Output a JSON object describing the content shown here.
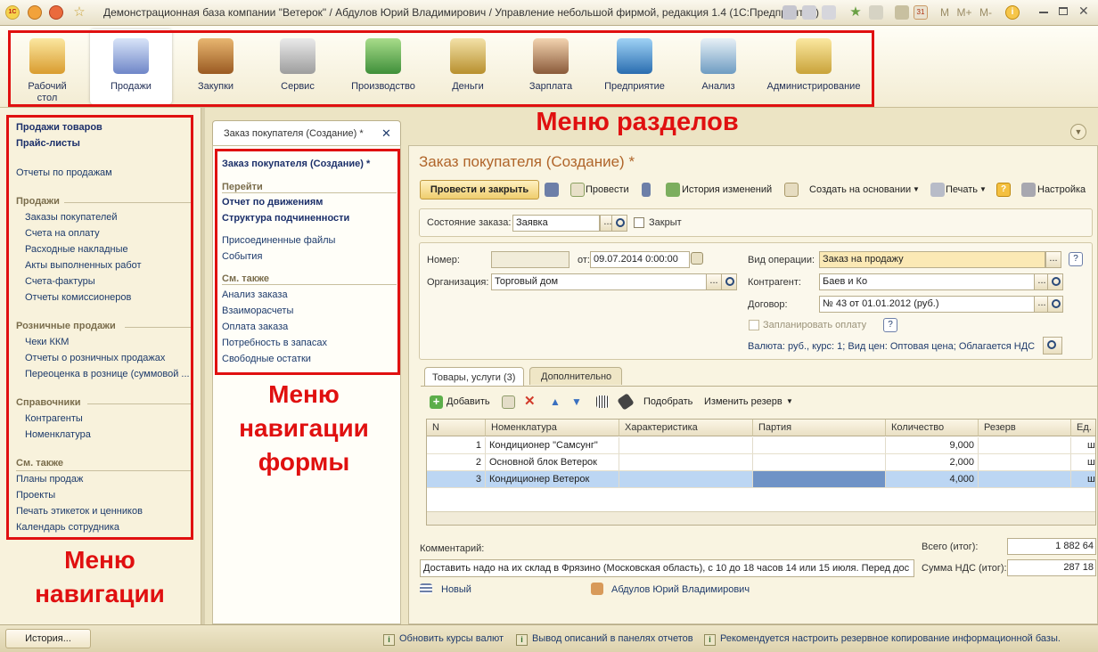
{
  "window": {
    "title": "Демонстрационная база компании \"Ветерок\" / Абдулов Юрий Владимирович / Управление небольшой фирмой, редакция 1.4  (1С:Предприятие)",
    "logo_text": "1С",
    "right_controls": [
      "M",
      "M+",
      "M-"
    ]
  },
  "sections": [
    {
      "label": "Рабочий стол",
      "icon": "desktop-icon"
    },
    {
      "label": "Продажи",
      "icon": "cart-icon",
      "active": true
    },
    {
      "label": "Закупки",
      "icon": "boxes-icon"
    },
    {
      "label": "Сервис",
      "icon": "tools-icon"
    },
    {
      "label": "Производство",
      "icon": "factory-icon"
    },
    {
      "label": "Деньги",
      "icon": "coins-icon"
    },
    {
      "label": "Зарплата",
      "icon": "employee-icon"
    },
    {
      "label": "Предприятие",
      "icon": "building-icon"
    },
    {
      "label": "Анализ",
      "icon": "chart-icon"
    },
    {
      "label": "Администрирование",
      "icon": "database-icon"
    }
  ],
  "annotations": {
    "sections_menu": "Меню разделов",
    "form_nav_menu_lines": [
      "Меню",
      "навигации",
      "формы"
    ],
    "nav_menu_lines": [
      "Меню",
      "навигации"
    ]
  },
  "left_nav": {
    "top_bold": [
      "Продажи товаров",
      "Прайс-листы"
    ],
    "reports": "Отчеты по продажам",
    "groups": [
      {
        "title": "Продажи",
        "items": [
          "Заказы покупателей",
          "Счета на оплату",
          "Расходные накладные",
          "Акты выполненных работ",
          "Счета-фактуры",
          "Отчеты комиссионеров"
        ]
      },
      {
        "title": "Розничные продажи",
        "items": [
          "Чеки ККМ",
          "Отчеты о розничных продажах",
          "Переоценка в рознице (суммовой ..."
        ]
      },
      {
        "title": "Справочники",
        "items": [
          "Контрагенты",
          "Номенклатура"
        ]
      }
    ],
    "see_also_title": "См. также",
    "see_also": [
      "Планы продаж",
      "Проекты",
      "Печать этикеток и ценников",
      "Календарь сотрудника"
    ]
  },
  "doc_tab": {
    "label": "Заказ покупателя (Создание) *",
    "close": "✕"
  },
  "form_nav": {
    "title": "Заказ покупателя (Создание) *",
    "go_title": "Перейти",
    "go_bold": [
      "Отчет по движениям",
      "Структура подчиненности"
    ],
    "go_items": [
      "Присоединенные файлы",
      "События"
    ],
    "see_also_title": "См. также",
    "see_also": [
      "Анализ заказа",
      "Взаиморасчеты",
      "Оплата заказа",
      "Потребность в запасах",
      "Свободные остатки"
    ]
  },
  "form": {
    "title": "Заказ покупателя (Создание) *",
    "toolbar": {
      "post_close": "Провести и закрыть",
      "post": "Провести",
      "history": "История изменений",
      "create_based": "Создать на основании",
      "print": "Печать",
      "settings": "Настройка"
    },
    "state_label": "Состояние заказа:",
    "state_value": "Заявка",
    "closed_label": "Закрыт",
    "number_label": "Номер:",
    "number_value": "",
    "date_label": "от:",
    "date_value": "09.07.2014  0:00:00",
    "org_label": "Организация:",
    "org_value": "Торговый дом",
    "optype_label": "Вид операции:",
    "optype_value": "Заказ на продажу",
    "counterparty_label": "Контрагент:",
    "counterparty_value": "Баев и Ко",
    "contract_label": "Договор:",
    "contract_value": "№ 43 от 01.01.2012 (руб.)",
    "plan_payment_label": "Запланировать оплату",
    "currency_info": "Валюта: руб., курс: 1; Вид цен: Оптовая цена; Облагается НДС",
    "help": "?",
    "tabs": [
      "Товары, услуги (3)",
      "Дополнительно"
    ],
    "table_toolbar": {
      "add": "Добавить",
      "pick": "Подобрать",
      "change_reserve": "Изменить резерв"
    },
    "columns": [
      "N",
      "Номенклатура",
      "Характеристика",
      "Партия",
      "Количество",
      "Резерв",
      "Ед."
    ],
    "rows": [
      {
        "n": "1",
        "name": "Кондиционер \"Самсунг\"",
        "char": "",
        "batch": "",
        "qty": "9,000",
        "reserve": "",
        "unit": "шт"
      },
      {
        "n": "2",
        "name": "Основной блок Ветерок",
        "char": "",
        "batch": "",
        "qty": "2,000",
        "reserve": "",
        "unit": "шт"
      },
      {
        "n": "3",
        "name": "Кондиционер Ветерок",
        "char": "",
        "batch": "",
        "qty": "4,000",
        "reserve": "",
        "unit": "шт"
      }
    ],
    "comment_label": "Комментарий:",
    "comment_value": "Доставить надо на их склад в Фрязино (Московская область), с 10 до 18 часов 14 или 15 июля. Перед дос",
    "total_label": "Всего (итог):",
    "total_value": "1 882 64",
    "vat_label": "Сумма НДС (итог):",
    "vat_value": "287 18",
    "status_new": "Новый",
    "author": "Абдулов Юрий Владимирович"
  },
  "statusbar": {
    "history": "История...",
    "messages": [
      "Обновить курсы валют",
      "Вывод описаний в панелях отчетов",
      "Рекомендуется настроить резервное копирование информационной базы."
    ]
  },
  "colors": {
    "annotation": "#e01010",
    "title_orange": "#b0652a",
    "link_blue": "#1c3a6b",
    "selected_row": "#bcd6f3"
  }
}
